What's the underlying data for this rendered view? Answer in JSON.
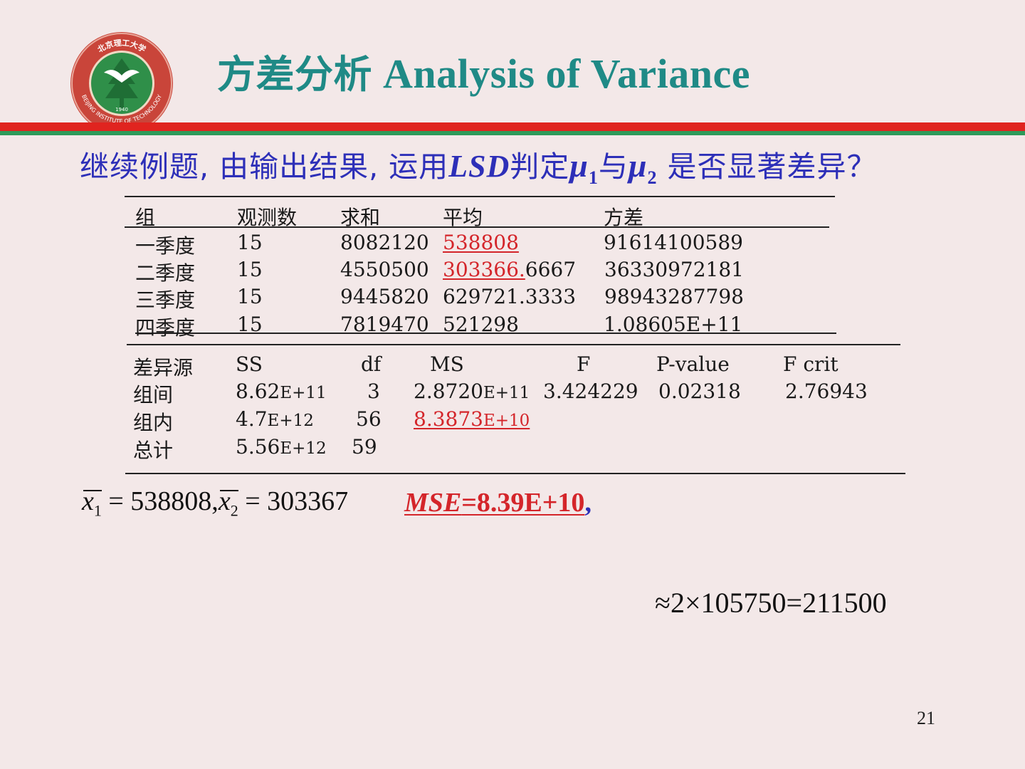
{
  "title": {
    "cjk": "方差分析",
    "en": "Analysis of Variance"
  },
  "logo": {
    "top_text": "北京理工大学",
    "ring_text": "BEIJING INSTITUTE OF TECHNOLOGY",
    "year": "1940"
  },
  "question": {
    "part1": "继续例题, 由输出结果, 运用",
    "lsd": "LSD",
    "part2": "判定",
    "mu": "μ",
    "sub1": "1",
    "mid": "与",
    "sub2": "2",
    "part3": " 是否显著差异？"
  },
  "summary_table": {
    "headers": [
      "组",
      "观测数",
      "求和",
      "平均",
      "方差"
    ],
    "rows": [
      {
        "group": "一季度",
        "count": "15",
        "sum": "8082120",
        "mean": "538808",
        "mean_rest": "",
        "variance": "91614100589"
      },
      {
        "group": "二季度",
        "count": "15",
        "sum": "4550500",
        "mean": "303366.",
        "mean_rest": "6667",
        "variance": "36330972181"
      },
      {
        "group": "三季度",
        "count": "15",
        "sum": "9445820",
        "mean": "629721.3333",
        "mean_rest": "",
        "variance": "98943287798"
      },
      {
        "group": "四季度",
        "count": "15",
        "sum": "7819470",
        "mean": "521298",
        "mean_rest": "",
        "variance": "1.08605E+11"
      }
    ]
  },
  "anova_table": {
    "headers": [
      "差异源",
      "SS",
      "df",
      "MS",
      "F",
      "P-value",
      "F crit"
    ],
    "rows": [
      {
        "source": "组间",
        "ss_a": "8.62",
        "ss_b": "E+11",
        "df": "3",
        "ms_a": "2.8720",
        "ms_b": "E+11",
        "f": "3.424229",
        "p": "0.02318",
        "fcrit": "2.76943"
      },
      {
        "source": "组内",
        "ss_a": "4.7",
        "ss_b": "E+12",
        "df": "56",
        "ms_a": "8.3873",
        "ms_b": "E+10"
      },
      {
        "source": "总计",
        "ss_a": "5.56",
        "ss_b": "E+12",
        "df": "59"
      }
    ]
  },
  "formula": {
    "x": "x",
    "sub1": "1",
    "eq1": " = 538808,",
    "sub2": "2",
    "eq2": " = 303367",
    "mse_label": "MSE",
    "mse_value": "=8.39E+10",
    "comma": ","
  },
  "approx": "≈2×105750=211500",
  "page_number": "21",
  "colors": {
    "background": "#f3e8e8",
    "title": "#1f8a86",
    "question": "#2d2fb8",
    "highlight": "#d4252a",
    "bar_red": "#e0241f",
    "bar_green": "#2e9a5a"
  }
}
